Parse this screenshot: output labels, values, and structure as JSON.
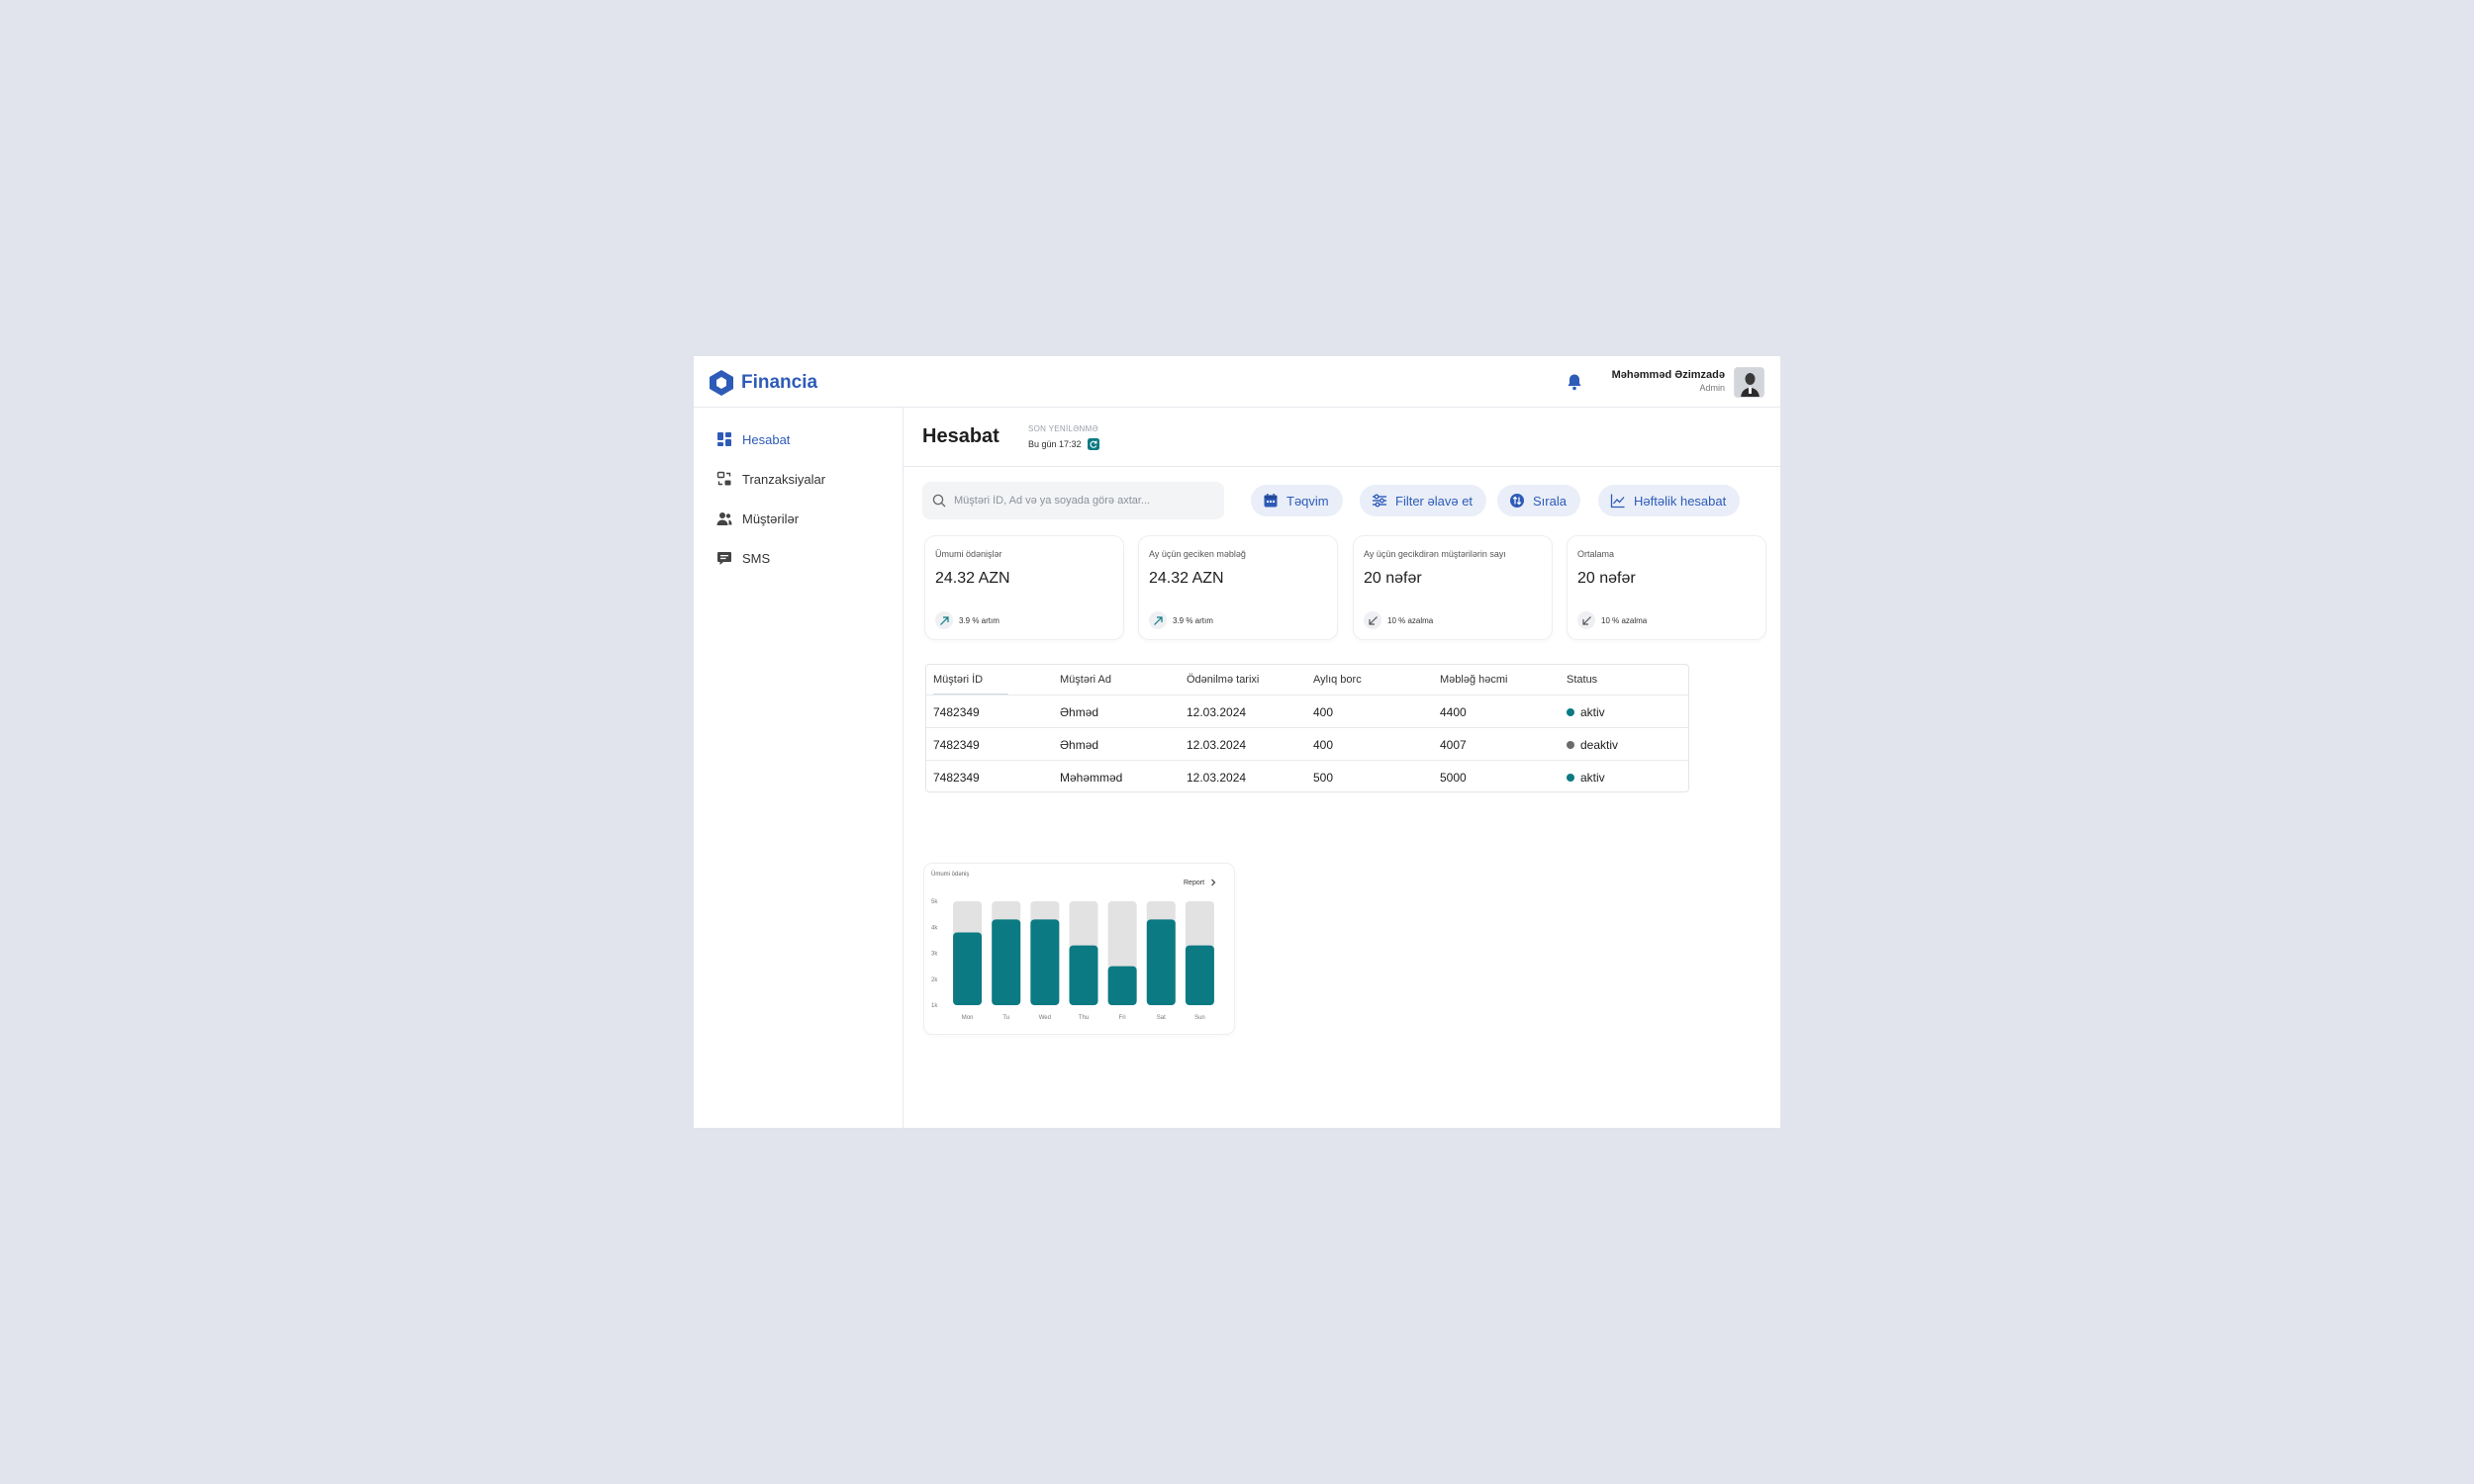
{
  "brand": {
    "name": "Financia",
    "color": "#2e5bb8"
  },
  "header": {
    "user_name": "Məhəmməd Əzimzadə",
    "user_role": "Admin"
  },
  "sidebar": {
    "items": [
      {
        "label": "Hesabat",
        "icon": "dashboard-grid-icon",
        "active": true
      },
      {
        "label": "Tranzaksiyalar",
        "icon": "transactions-icon",
        "active": false
      },
      {
        "label": "Müştərilər",
        "icon": "users-icon",
        "active": false
      },
      {
        "label": "SMS",
        "icon": "chat-bubble-icon",
        "active": false
      }
    ]
  },
  "page": {
    "title": "Hesabat",
    "last_update_label": "SON YENİLƏNMƏ",
    "last_update_value": "Bu gün 17:32"
  },
  "toolbar": {
    "search_placeholder": "Müştəri İD, Ad və ya soyada görə axtar...",
    "calendar_label": "Təqvim",
    "filter_label": "Filter əlavə et",
    "sort_label": "Sırala",
    "weekly_label": "Həftəlik hesabat"
  },
  "cards": [
    {
      "label": "Ümumi ödənişlər",
      "value": "24.32 AZN",
      "trend": "3.9 % artım",
      "direction": "up"
    },
    {
      "label": "Ay üçün geciken məbləğ",
      "value": "24.32 AZN",
      "trend": "3.9 % artım",
      "direction": "up"
    },
    {
      "label": "Ay üçün gecikdirən müştərilərin sayı",
      "value": "20 nəfər",
      "trend": "10 % azalma",
      "direction": "down"
    },
    {
      "label": "Ortalama",
      "value": "20 nəfər",
      "trend": "10 % azalma",
      "direction": "down"
    }
  ],
  "table": {
    "headers": [
      "Müştəri İD",
      "Müştəri Ad",
      "Ödənilmə tarixi",
      "Aylıq borc",
      "Məbləğ həcmi",
      "Status"
    ],
    "rows": [
      [
        "7482349",
        "Əhməd",
        "12.03.2024",
        "400",
        "4400",
        "aktiv"
      ],
      [
        "7482349",
        "Əhməd",
        "12.03.2024",
        "400",
        "4007",
        "deaktiv"
      ],
      [
        "7482349",
        "Məhəmməd",
        "12.03.2024",
        "500",
        "5000",
        "aktiv"
      ]
    ],
    "status_colors": {
      "aktiv": "#0b7a83",
      "deaktiv": "#6b6b6b"
    }
  },
  "chart": {
    "title": "Ümumi ödəniş",
    "report_label": "Report"
  },
  "chart_data": {
    "type": "bar",
    "categories": [
      "Mon",
      "Tu",
      "Wed",
      "Thu",
      "Fri",
      "Sat",
      "Sun"
    ],
    "y_ticks": [
      "5k",
      "4k",
      "3k",
      "2k",
      "1k"
    ],
    "ylim": [
      1,
      5
    ],
    "series": [
      {
        "values": [
          5,
          5,
          5,
          5,
          5,
          5,
          5
        ],
        "color": "#e2e2e2"
      },
      {
        "values": [
          3.8,
          4.3,
          4.3,
          3.3,
          2.5,
          4.3,
          3.3
        ],
        "color": "#0b7a83"
      }
    ]
  }
}
